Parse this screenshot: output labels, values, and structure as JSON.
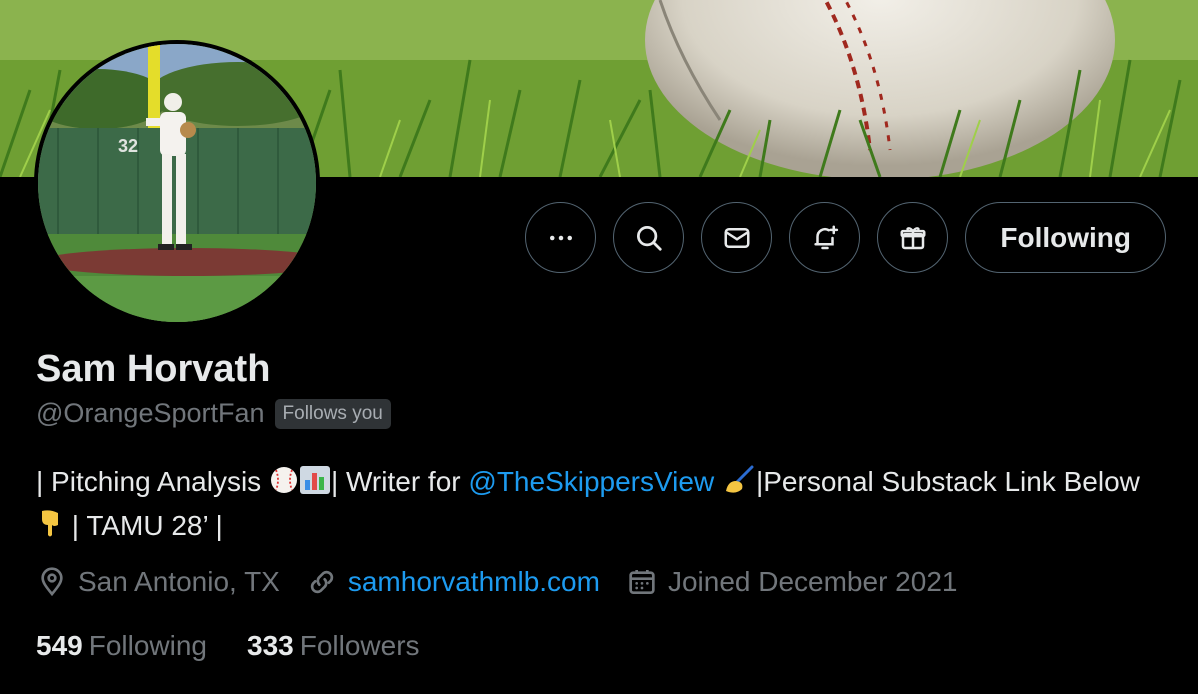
{
  "profile": {
    "name": "Sam Horvath",
    "handle": "@OrangeSportFan",
    "follows_you": "Follows you",
    "bio": {
      "part1": "| Pitching Analysis ",
      "part2": "| Writer for ",
      "mention": "@TheSkippersView",
      "part3": "|Personal Substack Link Below ",
      "part4": " | TAMU 28’ |"
    },
    "location": "San Antonio, TX",
    "website": "samhorvathmlb.com",
    "joined": "Joined December 2021",
    "following_count": "549",
    "following_label": "Following",
    "followers_count": "333",
    "followers_label": "Followers"
  },
  "actions": {
    "more_icon": "more-icon",
    "search_icon": "search-icon",
    "message_icon": "envelope-icon",
    "notify_icon": "bell-plus-icon",
    "gift_icon": "gift-icon",
    "follow_label": "Following"
  },
  "colors": {
    "background": "#000000",
    "link": "#1d9bf0",
    "secondary_text": "#71767b",
    "border": "#536471"
  }
}
